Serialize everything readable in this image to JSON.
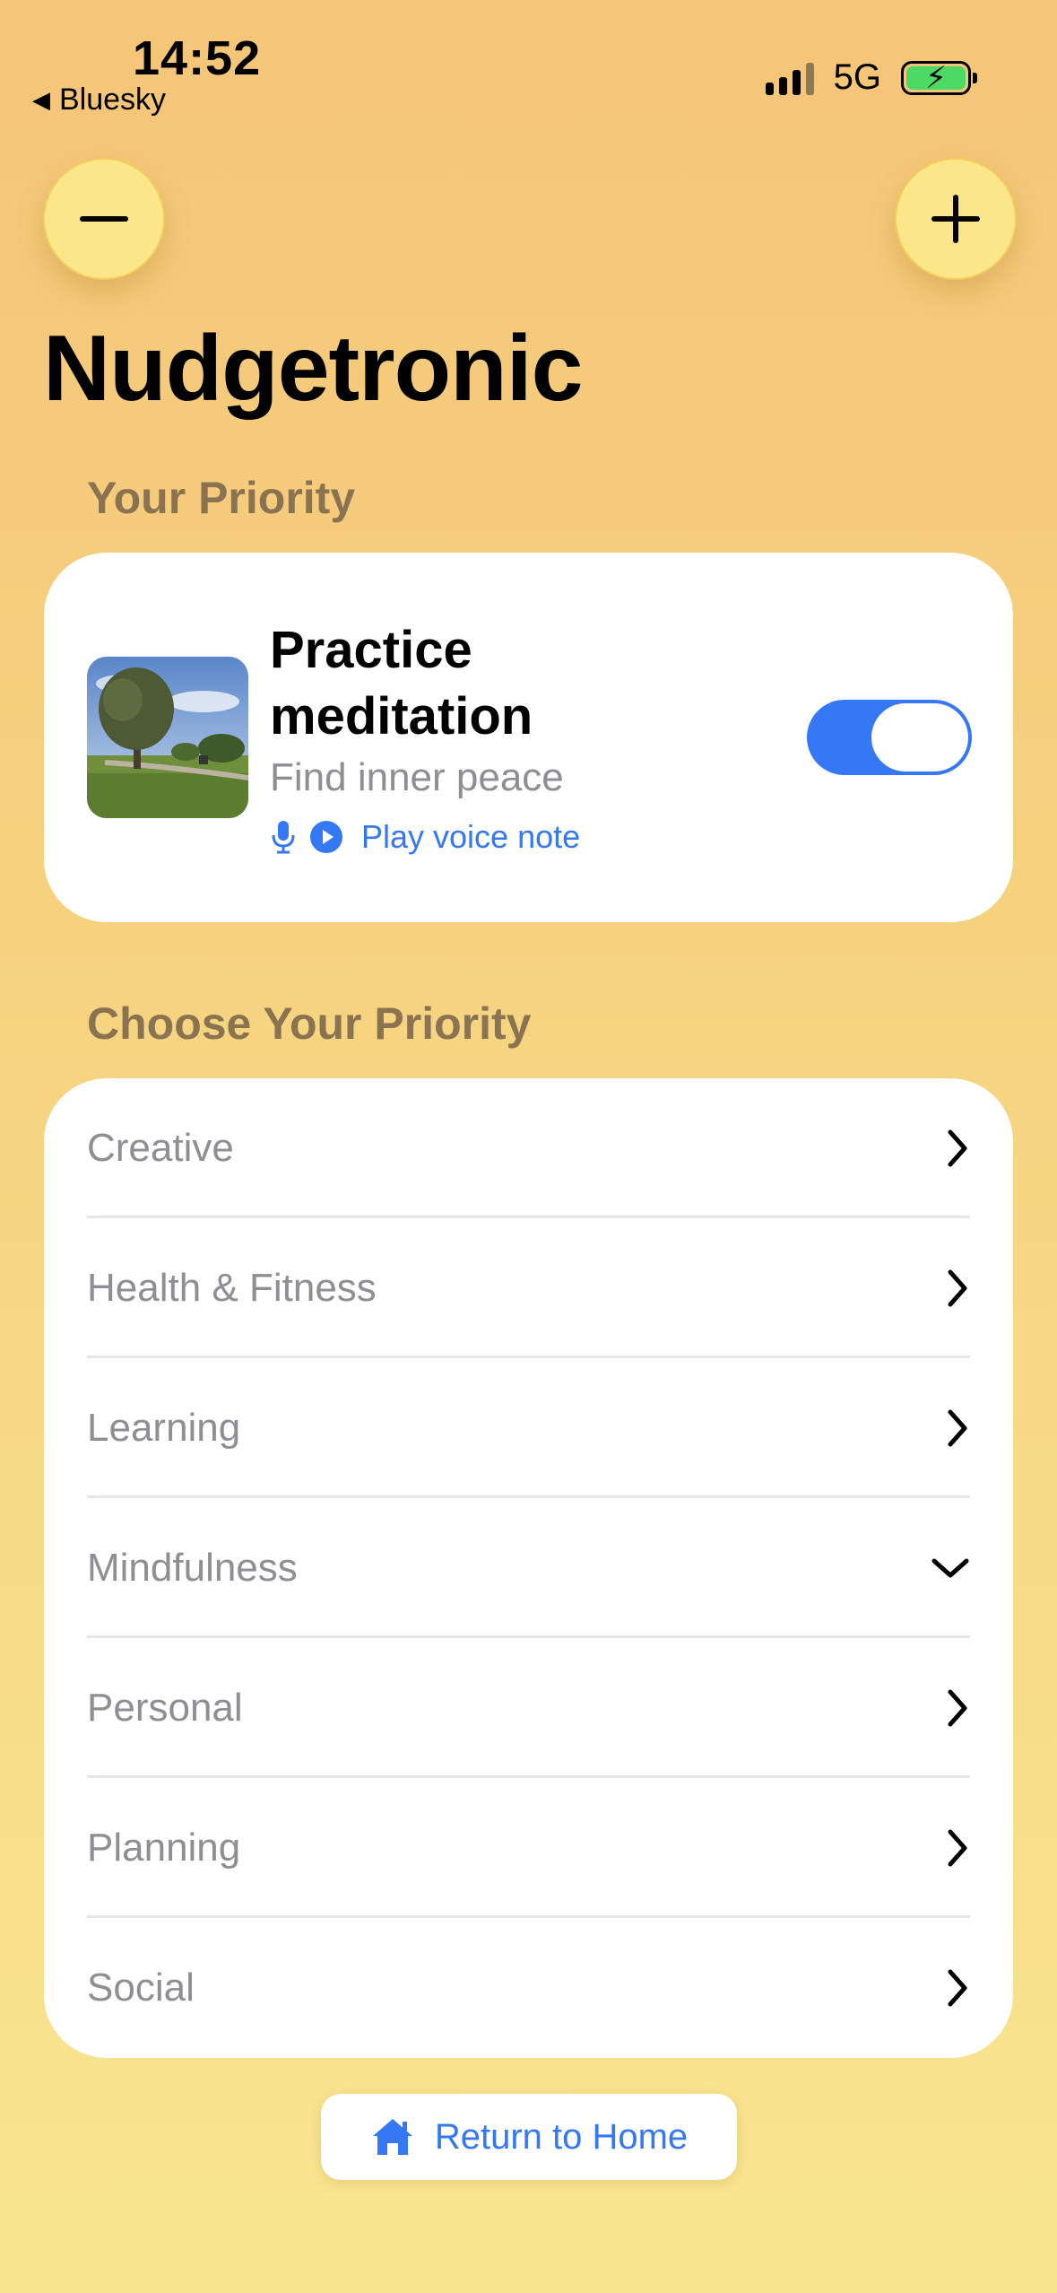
{
  "status_bar": {
    "time": "14:52",
    "back_app": "Bluesky",
    "network": "5G"
  },
  "app": {
    "title": "Nudgetronic"
  },
  "your_priority": {
    "section_label": "Your Priority",
    "title": "Practice meditation",
    "subtitle": "Find inner peace",
    "voice_note_label": "Play voice note",
    "enabled": true
  },
  "choose": {
    "section_label": "Choose Your Priority",
    "categories": [
      {
        "label": "Creative",
        "chevron": "chevron-right-icon"
      },
      {
        "label": "Health & Fitness",
        "chevron": "chevron-right-icon"
      },
      {
        "label": "Learning",
        "chevron": "chevron-right-icon"
      },
      {
        "label": "Mindfulness",
        "chevron": "chevron-down-icon"
      },
      {
        "label": "Personal",
        "chevron": "chevron-right-icon"
      },
      {
        "label": "Planning",
        "chevron": "chevron-right-icon"
      },
      {
        "label": "Social",
        "chevron": "chevron-right-icon"
      }
    ]
  },
  "footer": {
    "home_label": "Return to Home"
  },
  "colors": {
    "accent": "#3478f6",
    "circle_button": "#fbe68a",
    "section_label": "#8a7350"
  }
}
